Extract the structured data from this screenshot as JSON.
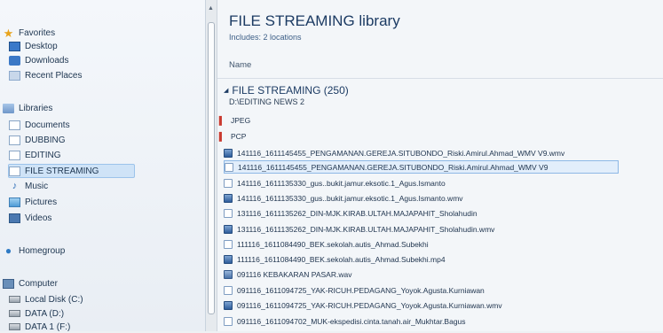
{
  "sidebar": {
    "favorites": "Favorites",
    "desktop": "Desktop",
    "downloads": "Downloads",
    "recent": "Recent Places",
    "libraries": "Libraries",
    "documents": "Documents",
    "dubbing": "DUBBING",
    "editing": "EDITING",
    "file_streaming": "FILE STREAMING",
    "music": "Music",
    "pictures": "Pictures",
    "videos": "Videos",
    "homegroup": "Homegroup",
    "computer": "Computer",
    "local_disk": "Local Disk (C:)",
    "data_d": "DATA (D:)",
    "data1": "DATA 1 (F:)"
  },
  "library": {
    "title": "FILE STREAMING library",
    "includes": "Includes: 2 locations",
    "column_name": "Name",
    "group_title": "FILE STREAMING (250)",
    "group_path": "D:\\EDITING NEWS 2"
  },
  "files": [
    "JPEG",
    "PCP",
    "141116_1611145455_PENGAMANAN.GEREJA.SITUBONDO_Riski.Amirul.Ahmad_WMV V9.wmv",
    "141116_1611145455_PENGAMANAN.GEREJA.SITUBONDO_Riski.Amirul.Ahmad_WMV V9",
    "141116_1611135330_gus..bukit.jamur.eksotic.1_Agus.Ismanto",
    "141116_1611135330_gus..bukit.jamur.eksotic.1_Agus.Ismanto.wmv",
    "131116_1611135262_DIN-MJK.KIRAB.ULTAH.MAJAPAHIT_Sholahudin",
    "131116_1611135262_DIN-MJK.KIRAB.ULTAH.MAJAPAHIT_Sholahudin.wmv",
    "111116_1611084490_BEK.sekolah.autis_Ahmad.Subekhi",
    "111116_1611084490_BEK.sekolah.autis_Ahmad.Subekhi.mp4",
    "091116 KEBAKARAN PASAR.wav",
    "091116_1611094725_YAK-RICUH.PEDAGANG_Yoyok.Agusta.Kurniawan",
    "091116_1611094725_YAK-RICUH.PEDAGANG_Yoyok.Agusta.Kurniawan.wmv",
    "091116_1611094702_MUK-ekspedisi.cinta.tanah.air_Mukhtar.Bagus"
  ]
}
